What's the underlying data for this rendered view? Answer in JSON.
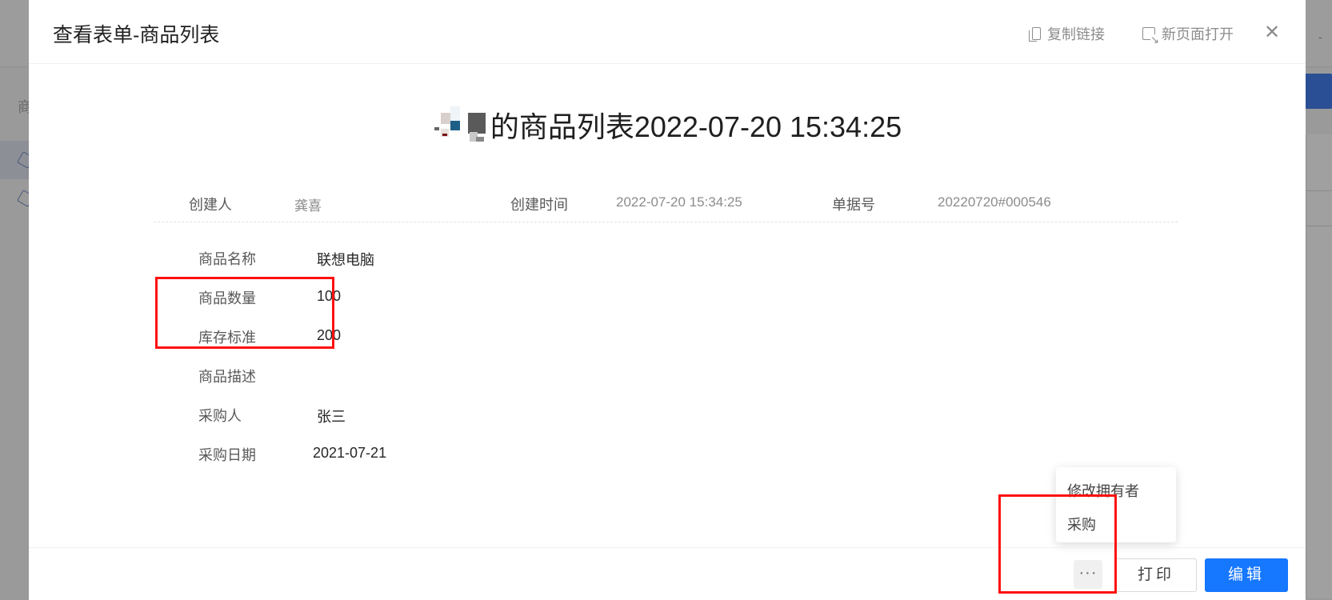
{
  "modal": {
    "title": "查看表单-商品列表",
    "copy_link_label": "复制链接",
    "new_page_label": "新页面打开",
    "close_glyph": "✕"
  },
  "document": {
    "title_text": "的商品列表2022-07-20 15:34:25",
    "meta": {
      "creator_label": "创建人",
      "creator_value": "龚喜",
      "created_time_label": "创建时间",
      "created_time_value": "2022-07-20 15:34:25",
      "doc_no_label": "单据号",
      "doc_no_value": "20220720#000546"
    },
    "fields": [
      {
        "label": "商品名称",
        "value": "联想电脑"
      },
      {
        "label": "商品数量",
        "value": "100"
      },
      {
        "label": "库存标准",
        "value": "200"
      },
      {
        "label": "商品描述",
        "value": ""
      },
      {
        "label": "采购人",
        "value": "张三"
      },
      {
        "label": "采购日期",
        "value": "2021-07-21"
      }
    ]
  },
  "dropdown": {
    "items": [
      "修改拥有者",
      "采购"
    ]
  },
  "footer": {
    "more_label": "···",
    "print_label": "打印",
    "edit_label": "编辑"
  },
  "background": {
    "side_char": "商"
  },
  "colors": {
    "primary": "#1677ff",
    "highlight_border": "#ff1010"
  }
}
